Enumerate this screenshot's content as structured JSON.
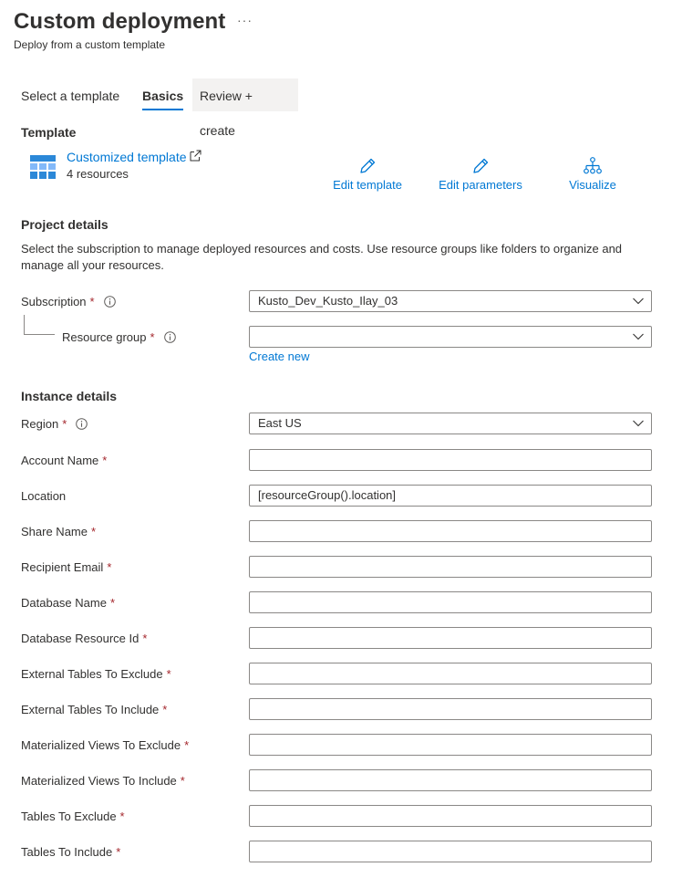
{
  "header": {
    "title": "Custom deployment",
    "more_label": "···",
    "subtitle": "Deploy from a custom template"
  },
  "tabs": [
    {
      "label": "Select a template",
      "active": false
    },
    {
      "label": "Basics",
      "active": true
    },
    {
      "label": "Review + create",
      "active": false
    }
  ],
  "template_section": {
    "title": "Template",
    "link_label": "Customized template",
    "resources": "4 resources",
    "actions": {
      "edit_template": "Edit template",
      "edit_parameters": "Edit parameters",
      "visualize": "Visualize"
    }
  },
  "project_details": {
    "title": "Project details",
    "description": "Select the subscription to manage deployed resources and costs. Use resource groups like folders to organize and manage all your resources.",
    "subscription": {
      "label": "Subscription",
      "value": "Kusto_Dev_Kusto_Ilay_03"
    },
    "resource_group": {
      "label": "Resource group",
      "value": "",
      "create_new": "Create new"
    }
  },
  "instance_details": {
    "title": "Instance details",
    "region": {
      "label": "Region",
      "value": "East US"
    },
    "fields": [
      {
        "label": "Account Name",
        "value": "",
        "required": true
      },
      {
        "label": "Location",
        "value": "[resourceGroup().location]",
        "required": false
      },
      {
        "label": "Share Name",
        "value": "",
        "required": true
      },
      {
        "label": "Recipient Email",
        "value": "",
        "required": true
      },
      {
        "label": "Database Name",
        "value": "",
        "required": true
      },
      {
        "label": "Database Resource Id",
        "value": "",
        "required": true
      },
      {
        "label": "External Tables To Exclude",
        "value": "",
        "required": true
      },
      {
        "label": "External Tables To Include",
        "value": "",
        "required": true
      },
      {
        "label": "Materialized Views To Exclude",
        "value": "",
        "required": true
      },
      {
        "label": "Materialized Views To Include",
        "value": "",
        "required": true
      },
      {
        "label": "Tables To Exclude",
        "value": "",
        "required": true
      },
      {
        "label": "Tables To Include",
        "value": "",
        "required": true
      }
    ]
  },
  "required_marker": "*",
  "colors": {
    "accent": "#0078d4",
    "required": "#a4262c",
    "border": "#8a8886"
  }
}
